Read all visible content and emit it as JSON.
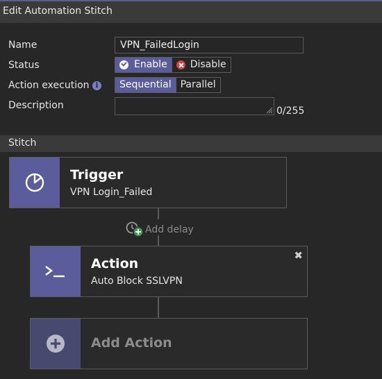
{
  "header": {
    "title": "Edit Automation Stitch"
  },
  "form": {
    "name_label": "Name",
    "name_value": "VPN_FailedLogin",
    "status_label": "Status",
    "status_options": {
      "enable": "Enable",
      "disable": "Disable"
    },
    "status_selected": "Enable",
    "action_execution_label": "Action execution",
    "execution_options": {
      "sequential": "Sequential",
      "parallel": "Parallel"
    },
    "execution_selected": "Sequential",
    "description_label": "Description",
    "description_value": "",
    "description_counter": "0/255"
  },
  "stitch": {
    "section_title": "Stitch",
    "trigger": {
      "title": "Trigger",
      "subtitle": "VPN Login_Failed",
      "icon": "pie-chart-icon"
    },
    "add_delay_label": "Add delay",
    "action": {
      "title": "Action",
      "subtitle": "Auto Block SSLVPN",
      "icon": "terminal-icon"
    },
    "add_action_label": "Add Action"
  },
  "colors": {
    "accent": "#5b5c9c",
    "disabled_accent": "#474a6e",
    "danger": "#d9404a",
    "success": "#3f9c4c"
  }
}
